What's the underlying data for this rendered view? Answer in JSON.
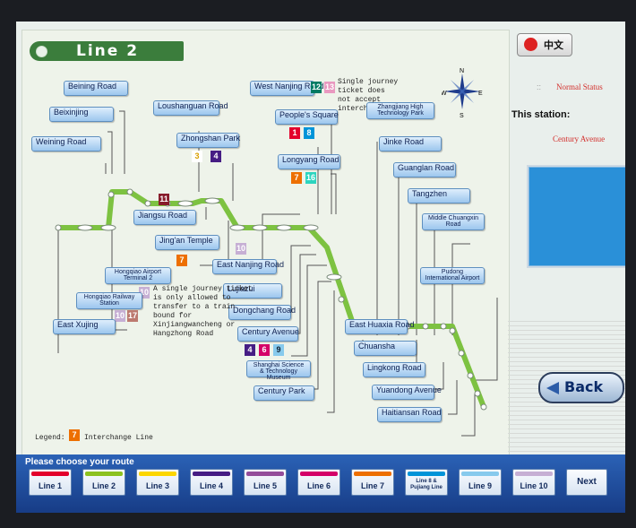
{
  "map": {
    "title": "Line 2",
    "compass": {
      "n": "N",
      "e": "E",
      "s": "S",
      "w": "W"
    },
    "stations": {
      "beining": "Beining Road",
      "beixinjing": "Beixinjing",
      "weining": "Weining Road",
      "loushanguan": "Loushanguan Road",
      "zhongshan": "Zhongshan Park",
      "jiangsu": "Jiangsu Road",
      "jingan": "Jing'an Temple",
      "westnanjing": "West Nanjing Road",
      "peoples": "People's Square",
      "eastnanjing": "East Nanjing Road",
      "lujiazui": "Lujiazui",
      "dongchang": "Dongchang Road",
      "century_ave": "Century Avenue",
      "science": "Shanghai Science & Technology Museum",
      "century_park": "Century Park",
      "longyang": "Longyang Road",
      "zhangjiang": "Zhangjiang High Technology Park",
      "jinke": "Jinke Road",
      "guanglan": "Guanglan Road",
      "tangzhen": "Tangzhen",
      "middlechuangxin": "Middle Chuangxin Road",
      "pudong_airport": "Pudong International Airport",
      "easthuaxia": "East Huaxia Road",
      "chuansha": "Chuansha",
      "lingkong": "Lingkong Road",
      "yuandong": "Yuandong Avenue",
      "haitiansan": "Haitiansan Road",
      "hongqiao_t2": "Hongqiao Airport Terminal 2",
      "hongqiao_rail": "Hongqiao Railway Station",
      "eastxujing": "East Xujing"
    },
    "interchanges": {
      "zhongshan": [
        "3",
        "4"
      ],
      "jiangsu": [
        "11"
      ],
      "jingan": [
        "7"
      ],
      "westnanjing": [
        "12",
        "13"
      ],
      "peoples": [
        "1",
        "8"
      ],
      "eastnanjing": [
        "10"
      ],
      "longyang": [
        "7",
        "16"
      ],
      "century_ave": [
        "4",
        "6",
        "9"
      ],
      "hongqiao_t2": [
        "10"
      ],
      "hongqiao_rail": [
        "10",
        "17"
      ]
    },
    "note_west_nanjing": "Single journey ticket does not accept interchange",
    "note_hongqiao": "A single journey ticket is only allowed to transfer to a train bound for Xinjiangwancheng or Hangzhong Road",
    "legend_label": "Legend:",
    "legend_example": "7",
    "legend_text": "Interchange Line"
  },
  "side": {
    "lang_button": "中文",
    "status_dots": "::",
    "status": "Normal Status",
    "this_station_label": "This station:",
    "current_station": "Century Avenue",
    "back_label": "Back"
  },
  "bottom": {
    "prompt": "Please choose your route",
    "lines": [
      "Line 1",
      "Line 2",
      "Line 3",
      "Line 4",
      "Line 5",
      "Line 6",
      "Line 7",
      "Line 8 & Pujiang Line",
      "Line 9",
      "Line 10"
    ],
    "next_label": "Next"
  },
  "colors": {
    "line2": "#7dc241",
    "line1": "#e3002b",
    "line2c": "#8cc220",
    "line3": "#fcd600",
    "line4": "#461d84",
    "line5": "#944d9a",
    "line6": "#d40068",
    "line7": "#ed6f00",
    "line8": "#0094d8",
    "line9": "#87caed",
    "line10": "#c6afd4",
    "line11": "#871c2b",
    "line12": "#007b63",
    "line13": "#e999c0",
    "line16": "#2dd5bf",
    "line17": "#bc796f"
  }
}
